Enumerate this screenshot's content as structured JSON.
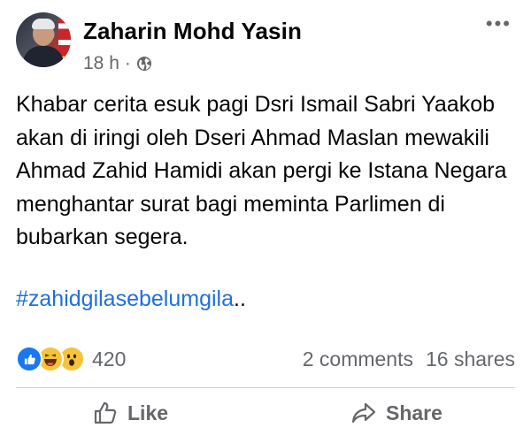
{
  "post": {
    "author": "Zaharin Mohd Yasin",
    "time": "18 h",
    "separator": "·",
    "privacy_icon": "globe-icon",
    "body": "Khabar cerita esuk pagi Dsri Ismail Sabri Yaakob akan di iringi oleh Dseri Ahmad Maslan mewakili Ahmad Zahid Hamidi akan pergi ke Istana Negara menghantar surat bagi meminta Parlimen di bubarkan segera.",
    "hashtag": "#zahidgilasebelumgila",
    "hashtag_suffix": ".."
  },
  "stats": {
    "reaction_icons": [
      "like-icon",
      "haha-icon",
      "wow-icon"
    ],
    "reaction_count": "420",
    "comments": "2 comments",
    "shares": "16 shares"
  },
  "actions": {
    "like_label": "Like",
    "share_label": "Share"
  },
  "colors": {
    "link": "#216fdb",
    "secondary_text": "#65676b",
    "like_blue": "#1877f2",
    "emoji_yellow": "#f7c33b"
  }
}
